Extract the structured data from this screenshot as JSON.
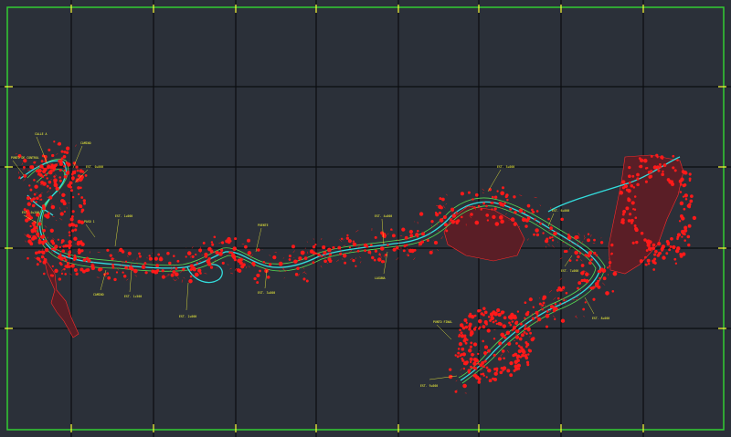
{
  "viewport": {
    "background": "#2b3039",
    "grid_color": "#0b0d10",
    "frame_color": "#33cc33",
    "tick_color": "#ffff33"
  },
  "drawing": {
    "layer_colors": {
      "terrain_dense": "#ff1a1a",
      "route_centerline": "#33dddd",
      "route_edges": "#55dd55",
      "annotation": "#ffff3a",
      "reservoir_fill": "#5a1e26"
    }
  },
  "labels": [
    {
      "id": "l01",
      "text": "CALLE A"
    },
    {
      "id": "l02",
      "text": "CAMINO"
    },
    {
      "id": "l03",
      "text": "PUNTO DE CONTROL"
    },
    {
      "id": "l04",
      "text": "EST. 0+000"
    },
    {
      "id": "l05",
      "text": "EST. 0+200"
    },
    {
      "id": "l06",
      "text": "PASO 1"
    },
    {
      "id": "l07",
      "text": "EST. 1+000"
    },
    {
      "id": "l08",
      "text": "EST. 1+500"
    },
    {
      "id": "l09",
      "text": "CAMINO"
    },
    {
      "id": "l10",
      "text": "EST. 2+000"
    },
    {
      "id": "l11",
      "text": "PUENTE"
    },
    {
      "id": "l12",
      "text": "EST. 3+000"
    },
    {
      "id": "l13",
      "text": "EST. 4+000"
    },
    {
      "id": "l14",
      "text": "LAGUNA"
    },
    {
      "id": "l15",
      "text": "EST. 5+000"
    },
    {
      "id": "l16",
      "text": "EST. 6+000"
    },
    {
      "id": "l17",
      "text": "EST. 7+000"
    },
    {
      "id": "l18",
      "text": "EST. 8+000"
    },
    {
      "id": "l19",
      "text": "PUNTO FINAL"
    },
    {
      "id": "l20",
      "text": "EST. 9+000"
    }
  ]
}
